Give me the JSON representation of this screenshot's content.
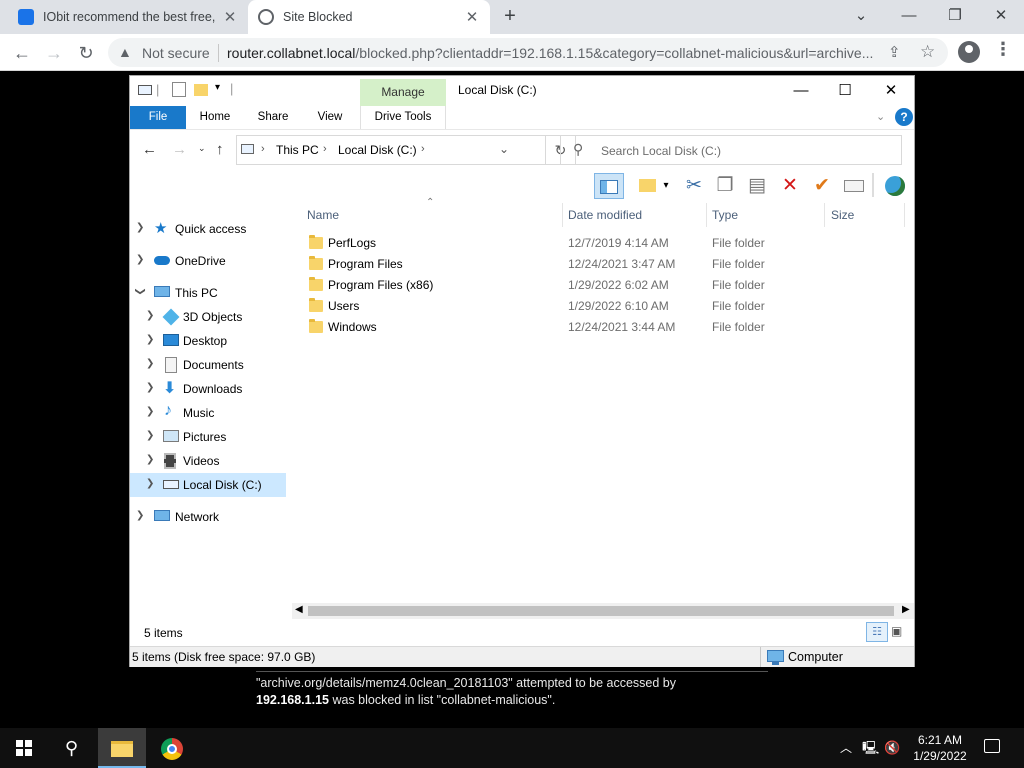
{
  "browser": {
    "tabs": [
      {
        "title": "IObit recommend the best free, t",
        "active": false,
        "favicon_color": "#1a73e8"
      },
      {
        "title": "Site Blocked",
        "active": true,
        "favicon_color": "#5f6368"
      }
    ],
    "omnibox": {
      "security_label": "Not secure",
      "url_host": "router.collabnet.local",
      "url_rest": "/blocked.php?clientaddr=192.168.1.15&category=collabnet-malicious&url=archive..."
    }
  },
  "explorer": {
    "title": "Local Disk (C:)",
    "manage_label": "Manage",
    "ribbon_tabs": [
      "File",
      "Home",
      "Share",
      "View",
      "Drive Tools"
    ],
    "breadcrumb": [
      "This PC",
      "Local Disk (C:)"
    ],
    "search_placeholder": "Search Local Disk (C:)",
    "nav": {
      "quick_access": "Quick access",
      "onedrive": "OneDrive",
      "this_pc": "This PC",
      "objects3d": "3D Objects",
      "desktop": "Desktop",
      "documents": "Documents",
      "downloads": "Downloads",
      "music": "Music",
      "pictures": "Pictures",
      "videos": "Videos",
      "local_disk": "Local Disk (C:)",
      "network": "Network"
    },
    "columns": {
      "name": "Name",
      "date": "Date modified",
      "type": "Type",
      "size": "Size"
    },
    "files": [
      {
        "name": "PerfLogs",
        "date": "12/7/2019 4:14 AM",
        "type": "File folder"
      },
      {
        "name": "Program Files",
        "date": "12/24/2021 3:47 AM",
        "type": "File folder"
      },
      {
        "name": "Program Files (x86)",
        "date": "1/29/2022 6:02 AM",
        "type": "File folder"
      },
      {
        "name": "Users",
        "date": "1/29/2022 6:10 AM",
        "type": "File folder"
      },
      {
        "name": "Windows",
        "date": "12/24/2021 3:44 AM",
        "type": "File folder"
      }
    ],
    "item_count": "5 items",
    "status_left": "5 items (Disk free space: 97.0 GB)",
    "status_right": "Computer"
  },
  "blocked": {
    "line1": "\"archive.org/details/memz4.0clean_20181103\" attempted to be accessed by",
    "ip": "192.168.1.15",
    "line2_rest": " was blocked in list \"collabnet-malicious\"."
  },
  "taskbar": {
    "time": "6:21 AM",
    "date": "1/29/2022"
  }
}
